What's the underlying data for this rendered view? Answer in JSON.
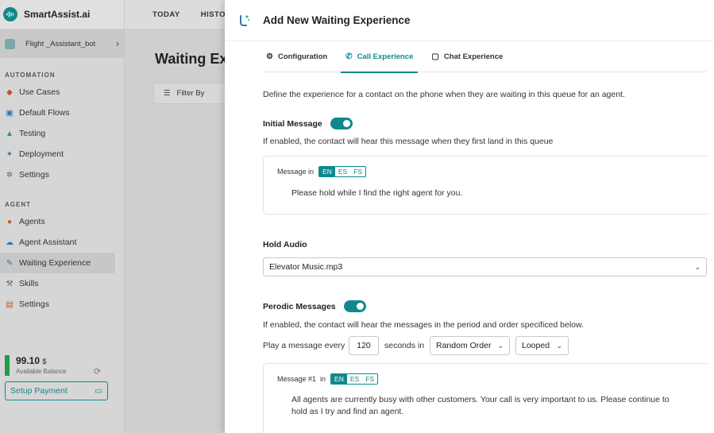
{
  "brand": {
    "name": "SmartAssist.ai"
  },
  "bot": {
    "name": "Flight _Assistant_bot"
  },
  "topnav": {
    "today": "TODAY",
    "history": "HISTO"
  },
  "sidebar": {
    "automation_title": "AUTOMATION",
    "automation_items": [
      {
        "label": "Use Cases",
        "icon": "use-cases-icon",
        "color": "#d04a2a"
      },
      {
        "label": "Default Flows",
        "icon": "default-flows-icon",
        "color": "#2a7ab8"
      },
      {
        "label": "Testing",
        "icon": "testing-icon",
        "color": "#2a9a5a"
      },
      {
        "label": "Deployment",
        "icon": "deployment-icon",
        "color": "#2a7ab8"
      },
      {
        "label": "Settings",
        "icon": "settings-icon",
        "color": "#666666"
      }
    ],
    "agent_title": "AGENT",
    "agent_items": [
      {
        "label": "Agents",
        "icon": "agents-icon",
        "color": "#c05a2a"
      },
      {
        "label": "Agent Assistant",
        "icon": "agent-assistant-icon",
        "color": "#2a7ab8"
      },
      {
        "label": "Waiting Experience",
        "icon": "waiting-experience-icon",
        "color": "#2a7ab8"
      },
      {
        "label": "Skills",
        "icon": "skills-icon",
        "color": "#666666"
      },
      {
        "label": "Settings",
        "icon": "settings-icon",
        "color": "#c05a2a"
      }
    ],
    "balance": {
      "value": "99.10",
      "unit": "$",
      "label": "Available Balance"
    },
    "setup_payment": "Setup Payment"
  },
  "main": {
    "title": "Waiting Ex",
    "filter": "Filter By"
  },
  "drawer": {
    "title": "Add New Waiting Experience",
    "tabs": [
      {
        "label": "Configuration",
        "icon": "gear-icon"
      },
      {
        "label": "Call Experience",
        "icon": "phone-icon"
      },
      {
        "label": "Chat Experience",
        "icon": "chat-icon"
      }
    ],
    "description": "Define the experience for a contact on the phone when they are waiting in this queue for an agent.",
    "initial": {
      "label": "Initial Message",
      "hint": "If enabled, the contact will hear this message when they first land in this queue",
      "message_in": "Message in",
      "langs": [
        "EN",
        "ES",
        "FS"
      ],
      "message": "Please hold while I find the right agent for you."
    },
    "hold_audio": {
      "label": "Hold Audio",
      "value": "Elevator Music.mp3"
    },
    "periodic": {
      "label": "Perodic Messages",
      "hint": "If enabled, the contact will hear the messages in the period and order specificed below.",
      "play_prefix": "Play a message every",
      "seconds": "120",
      "seconds_suffix": "seconds in",
      "order": "Random Order",
      "loop": "Looped",
      "message_label": "Message #1  in",
      "langs": [
        "EN",
        "ES",
        "FS"
      ],
      "message_line1": "All agents are currently busy with other customers. Your call is very important to us. Please continue to",
      "message_line2": "hold as I try and find an agent."
    }
  }
}
